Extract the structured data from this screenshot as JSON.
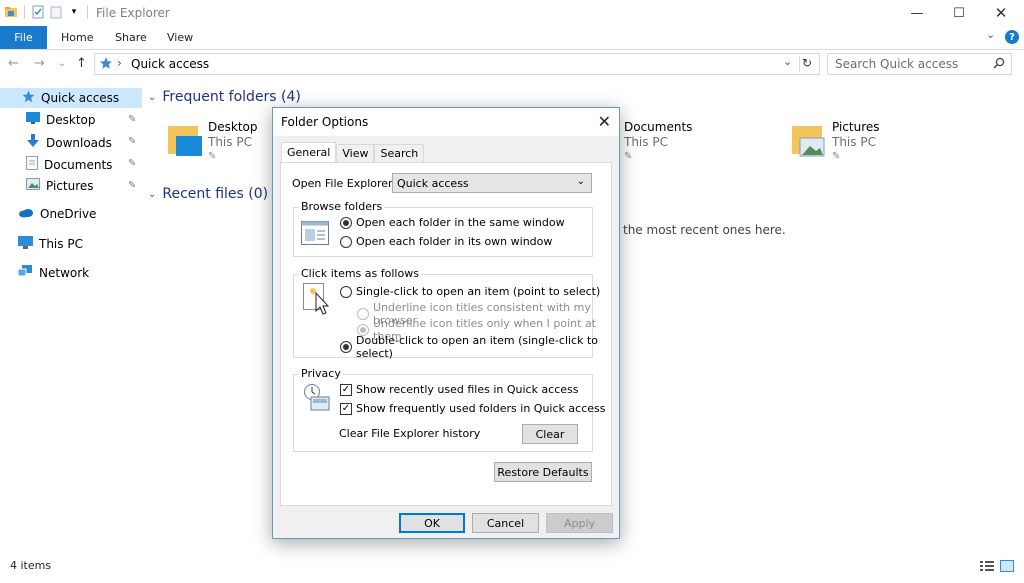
{
  "window": {
    "title": "File Explorer",
    "controls": {
      "minimize": "—",
      "maximize": "☐",
      "close": "✕"
    }
  },
  "ribbon": {
    "tabs": [
      {
        "label": "File"
      },
      {
        "label": "Home"
      },
      {
        "label": "Share"
      },
      {
        "label": "View"
      }
    ],
    "help": "?",
    "chevron": "⌄"
  },
  "address_bar": {
    "back": "←",
    "forward": "→",
    "recent": "⌄",
    "up": "↑",
    "location": "Quick access",
    "separator": "›",
    "refresh": "↻",
    "search_placeholder": "Search Quick access"
  },
  "nav_pane": {
    "items": [
      {
        "label": "Quick access",
        "icon": "star-icon",
        "selected": true
      },
      {
        "label": "Desktop",
        "icon": "desktop-icon",
        "pinned": true
      },
      {
        "label": "Downloads",
        "icon": "download-icon",
        "pinned": true
      },
      {
        "label": "Documents",
        "icon": "documents-icon",
        "pinned": true
      },
      {
        "label": "Pictures",
        "icon": "pictures-icon",
        "pinned": true
      },
      {
        "label": "OneDrive",
        "icon": "cloud-icon"
      },
      {
        "label": "This PC",
        "icon": "computer-icon"
      },
      {
        "label": "Network",
        "icon": "network-icon"
      }
    ],
    "pin_glyph": "📌"
  },
  "content": {
    "frequent_folders_heading": "Frequent folders (4)",
    "recent_files_heading": "Recent files (0)",
    "recent_files_hint": "the most recent ones here.",
    "folders": [
      {
        "name": "Desktop",
        "location": "This PC"
      },
      {
        "name": "Documents",
        "location": "This PC"
      },
      {
        "name": "Pictures",
        "location": "This PC"
      }
    ]
  },
  "status_bar": {
    "item_count": "4 items"
  },
  "dialog": {
    "title": "Folder Options",
    "close": "✕",
    "tabs": [
      {
        "label": "General",
        "active": true
      },
      {
        "label": "View"
      },
      {
        "label": "Search"
      }
    ],
    "open_explorer_label": "Open File Explorer to:",
    "open_explorer_value": "Quick access",
    "browse_folders": {
      "label": "Browse folders",
      "options": [
        {
          "label": "Open each folder in the same window",
          "selected": true
        },
        {
          "label": "Open each folder in its own window",
          "selected": false
        }
      ]
    },
    "click_items": {
      "label": "Click items as follows",
      "single_click": "Single-click to open an item (point to select)",
      "underline_browser": "Underline icon titles consistent with my browser",
      "underline_point": "Underline icon titles only when I point at them",
      "double_click": "Double-click to open an item (single-click to select)"
    },
    "privacy": {
      "label": "Privacy",
      "show_recent_files": "Show recently used files in Quick access",
      "show_frequent_folders": "Show frequently used folders in Quick access",
      "clear_history_label": "Clear File Explorer history",
      "clear_button": "Clear"
    },
    "restore_defaults": "Restore Defaults",
    "ok": "OK",
    "cancel": "Cancel",
    "apply": "Apply",
    "check_glyph": "✓"
  },
  "colors": {
    "accent": "#1979ca",
    "selection": "#cce8ff",
    "heading": "#1e3287",
    "folder": "#f3c55a"
  }
}
